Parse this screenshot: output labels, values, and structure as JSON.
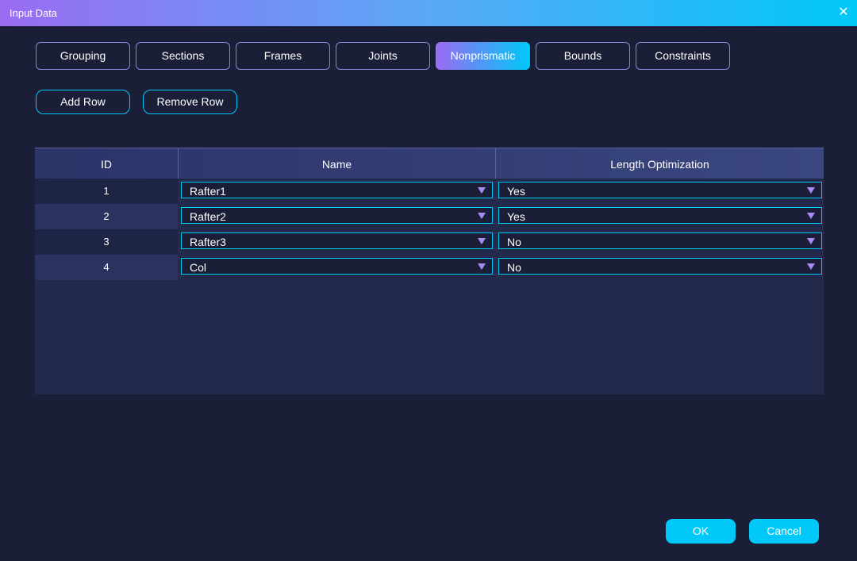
{
  "window": {
    "title": "Input Data",
    "close_icon": "close-icon"
  },
  "tabs": [
    {
      "label": "Grouping",
      "active": false
    },
    {
      "label": "Sections",
      "active": false
    },
    {
      "label": "Frames",
      "active": false
    },
    {
      "label": "Joints",
      "active": false
    },
    {
      "label": "Nonprismatic",
      "active": true
    },
    {
      "label": "Bounds",
      "active": false
    },
    {
      "label": "Constraints",
      "active": false
    }
  ],
  "actions": {
    "add_row": "Add Row",
    "remove_row": "Remove Row"
  },
  "table": {
    "headers": {
      "id": "ID",
      "name": "Name",
      "length": "Length Optimization"
    },
    "rows": [
      {
        "id": "1",
        "name": "Rafter1",
        "length": "Yes"
      },
      {
        "id": "2",
        "name": "Rafter2",
        "length": "Yes"
      },
      {
        "id": "3",
        "name": "Rafter3",
        "length": "No"
      },
      {
        "id": "4",
        "name": "Col",
        "length": "No"
      }
    ]
  },
  "footer": {
    "ok": "OK",
    "cancel": "Cancel"
  },
  "colors": {
    "background": "#1a1f37",
    "accent_cyan": "#00c8f8",
    "accent_purple": "#9a6cf2",
    "caret": "#a98bf5"
  }
}
